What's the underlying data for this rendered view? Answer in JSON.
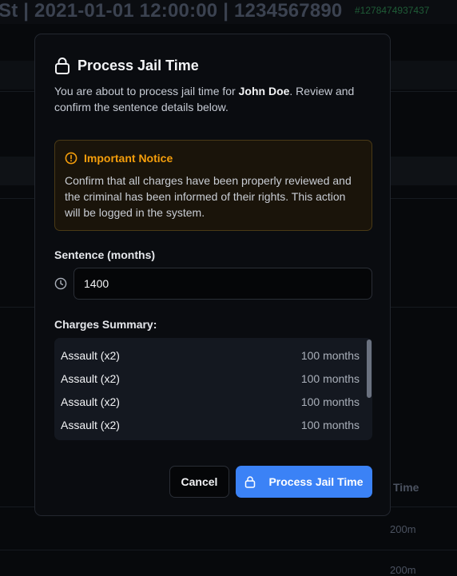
{
  "background": {
    "header_text": "St | 2021-01-01 12:00:00 | 1234567890",
    "header_id": "#1278474937437",
    "table_column": "Time",
    "table_cells": [
      "200m",
      "200m"
    ]
  },
  "modal": {
    "title": "Process Jail Time",
    "description_prefix": "You are about to process jail time for ",
    "subject_name": "John Doe",
    "description_suffix": ". Review and confirm the sentence details below.",
    "notice": {
      "title": "Important Notice",
      "text": "Confirm that all charges have been properly reviewed and the criminal has been informed of their rights. This action will be logged in the system."
    },
    "sentence_label": "Sentence (months)",
    "sentence_value": "1400",
    "charges_label": "Charges Summary:",
    "charges": [
      {
        "name": "Assault (x2)",
        "length": "100 months"
      },
      {
        "name": "Assault (x2)",
        "length": "100 months"
      },
      {
        "name": "Assault (x2)",
        "length": "100 months"
      },
      {
        "name": "Assault (x2)",
        "length": "100 months"
      }
    ],
    "cancel_label": "Cancel",
    "submit_label": "Process Jail Time"
  },
  "colors": {
    "accent": "#3b82f6",
    "warning": "#f59e0b",
    "background": "#07090c"
  },
  "icons": {
    "title_icon": "lock-icon",
    "notice_icon": "alert-circle-icon",
    "sentence_icon": "clock-icon",
    "submit_icon": "lock-icon"
  }
}
